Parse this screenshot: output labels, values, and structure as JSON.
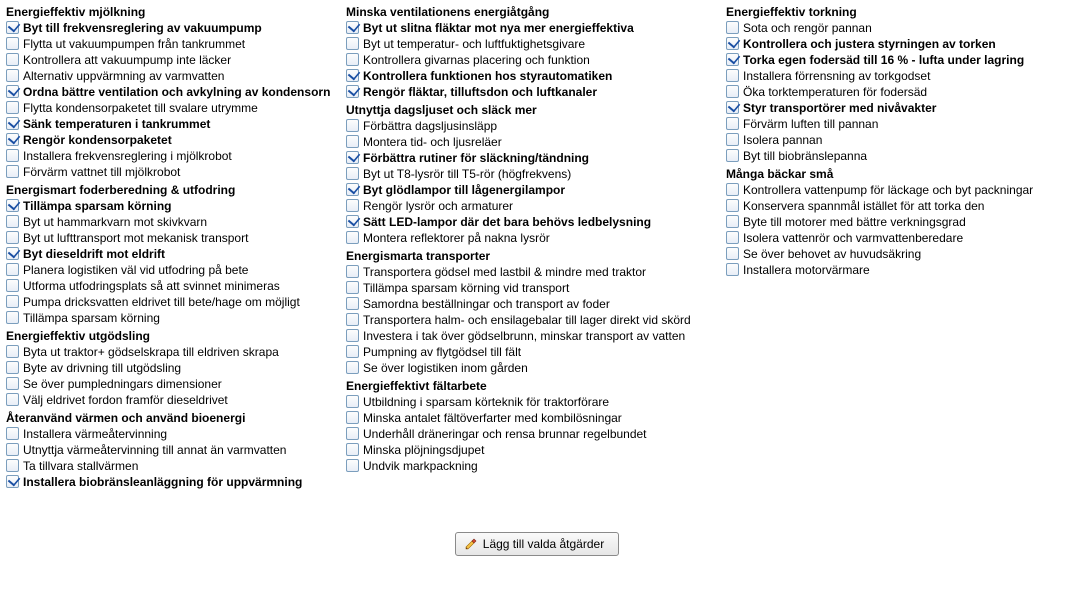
{
  "button_label": "Lägg till valda åtgärder",
  "columns": [
    {
      "groups": [
        {
          "title": "Energieffektiv mjölkning",
          "items": [
            {
              "label": "Byt till frekvensreglering av vakuumpump",
              "checked": true
            },
            {
              "label": "Flytta ut vakuumpumpen från tankrummet",
              "checked": false
            },
            {
              "label": "Kontrollera  att vakuumpump inte läcker",
              "checked": false
            },
            {
              "label": "Alternativ uppvärmning av varmvatten",
              "checked": false
            },
            {
              "label": "Ordna bättre ventilation och avkylning av kondensorn",
              "checked": true
            },
            {
              "label": "Flytta kondensorpaketet till svalare utrymme",
              "checked": false
            },
            {
              "label": "Sänk temperaturen i tankrummet",
              "checked": true
            },
            {
              "label": "Rengör kondensorpaketet",
              "checked": true
            },
            {
              "label": "Installera frekvensreglering i mjölkrobot",
              "checked": false
            },
            {
              "label": "Förvärm vattnet till mjölkrobot",
              "checked": false
            }
          ]
        },
        {
          "title": "Energismart foderberedning & utfodring",
          "items": [
            {
              "label": "Tillämpa sparsam körning",
              "checked": true
            },
            {
              "label": "Byt ut hammarkvarn mot skivkvarn",
              "checked": false
            },
            {
              "label": "Byt ut lufttransport mot mekanisk transport",
              "checked": false
            },
            {
              "label": "Byt dieseldrift mot eldrift",
              "checked": true
            },
            {
              "label": "Planera logistiken väl vid utfodring på bete",
              "checked": false
            },
            {
              "label": "Utforma utfodringsplats så att svinnet minimeras",
              "checked": false
            },
            {
              "label": "Pumpa dricksvatten eldrivet till bete/hage om möjligt",
              "checked": false
            },
            {
              "label": "Tillämpa sparsam körning",
              "checked": false
            }
          ]
        },
        {
          "title": "Energieffektiv utgödsling",
          "items": [
            {
              "label": "Byta ut traktor+ gödselskrapa till eldriven skrapa",
              "checked": false
            },
            {
              "label": "Byte av drivning till utgödsling",
              "checked": false
            },
            {
              "label": "Se över pumpledningars dimensioner",
              "checked": false
            },
            {
              "label": "Välj eldrivet fordon framför dieseldrivet",
              "checked": false
            }
          ]
        },
        {
          "title": "Återanvänd värmen och använd bioenergi",
          "items": [
            {
              "label": "Installera värmeåtervinning",
              "checked": false
            },
            {
              "label": "Utnyttja värmeåtervinning till annat än varmvatten",
              "checked": false
            },
            {
              "label": "Ta tillvara stallvärmen",
              "checked": false
            },
            {
              "label": "Installera biobränsleanläggning för uppvärmning",
              "checked": true
            }
          ]
        }
      ]
    },
    {
      "groups": [
        {
          "title": "Minska ventilationens energiåtgång",
          "items": [
            {
              "label": "Byt ut slitna fläktar mot nya mer energieffektiva",
              "checked": true
            },
            {
              "label": "Byt ut temperatur- och luftfuktighetsgivare",
              "checked": false
            },
            {
              "label": "Kontrollera givarnas placering och funktion",
              "checked": false
            },
            {
              "label": "Kontrollera funktionen hos styrautomatiken",
              "checked": true
            },
            {
              "label": "Rengör fläktar, tilluftsdon och luftkanaler",
              "checked": true
            }
          ]
        },
        {
          "title": "Utnyttja dagsljuset och släck mer",
          "items": [
            {
              "label": "Förbättra dagsljusinsläpp",
              "checked": false
            },
            {
              "label": "Montera tid- och ljusreläer",
              "checked": false
            },
            {
              "label": "Förbättra rutiner för släckning/tändning",
              "checked": true
            },
            {
              "label": "Byt ut T8-lysrör till T5-rör (högfrekvens)",
              "checked": false
            },
            {
              "label": "Byt glödlampor till lågenergilampor",
              "checked": true
            },
            {
              "label": "Rengör lysrör och armaturer",
              "checked": false
            },
            {
              "label": "Sätt LED-lampor där det bara behövs ledbelysning",
              "checked": true
            },
            {
              "label": "Montera reflektorer på nakna lysrör",
              "checked": false
            }
          ]
        },
        {
          "title": "Energismarta transporter",
          "items": [
            {
              "label": "Transportera gödsel med lastbil & mindre med traktor",
              "checked": false
            },
            {
              "label": "Tillämpa sparsam körning vid transport",
              "checked": false
            },
            {
              "label": "Samordna beställningar och transport av foder",
              "checked": false
            },
            {
              "label": "Transportera  halm- och ensilagebalar till lager direkt vid skörd",
              "checked": false
            },
            {
              "label": "Investera i tak över gödselbrunn, minskar transport av vatten",
              "checked": false
            },
            {
              "label": "Pumpning av flytgödsel till fält",
              "checked": false
            },
            {
              "label": "Se över logistiken inom gården",
              "checked": false
            }
          ]
        },
        {
          "title": "Energieffektivt fältarbete",
          "items": [
            {
              "label": "Utbildning i sparsam körteknik för traktorförare",
              "checked": false
            },
            {
              "label": "Minska antalet fältöverfarter med kombilösningar",
              "checked": false
            },
            {
              "label": "Underhåll dräneringar och rensa brunnar regelbundet",
              "checked": false
            },
            {
              "label": "Minska plöjningsdjupet",
              "checked": false
            },
            {
              "label": "Undvik markpackning",
              "checked": false
            }
          ]
        }
      ]
    },
    {
      "groups": [
        {
          "title": "Energieffektiv torkning",
          "items": [
            {
              "label": "Sota och rengör pannan",
              "checked": false
            },
            {
              "label": "Kontrollera och justera styrningen av torken",
              "checked": true
            },
            {
              "label": "Torka egen fodersäd till 16 % - lufta under lagring",
              "checked": true
            },
            {
              "label": "Installera förrensning av torkgodset",
              "checked": false
            },
            {
              "label": "Öka torktemperaturen för fodersäd",
              "checked": false
            },
            {
              "label": "Styr transportörer med nivåvakter",
              "checked": true
            },
            {
              "label": "Förvärm luften till pannan",
              "checked": false
            },
            {
              "label": "Isolera pannan",
              "checked": false
            },
            {
              "label": "Byt till biobränslepanna",
              "checked": false
            }
          ]
        },
        {
          "title": "Många bäckar små",
          "items": [
            {
              "label": "Kontrollera vattenpump för läckage och byt packningar",
              "checked": false
            },
            {
              "label": "Konservera spannmål  istället för att torka den",
              "checked": false
            },
            {
              "label": "Byte till motorer med bättre verkningsgrad",
              "checked": false
            },
            {
              "label": "Isolera vattenrör och varmvattenberedare",
              "checked": false
            },
            {
              "label": "Se över behovet av huvudsäkring",
              "checked": false
            },
            {
              "label": "Installera motorvärmare",
              "checked": false
            }
          ]
        }
      ]
    }
  ]
}
